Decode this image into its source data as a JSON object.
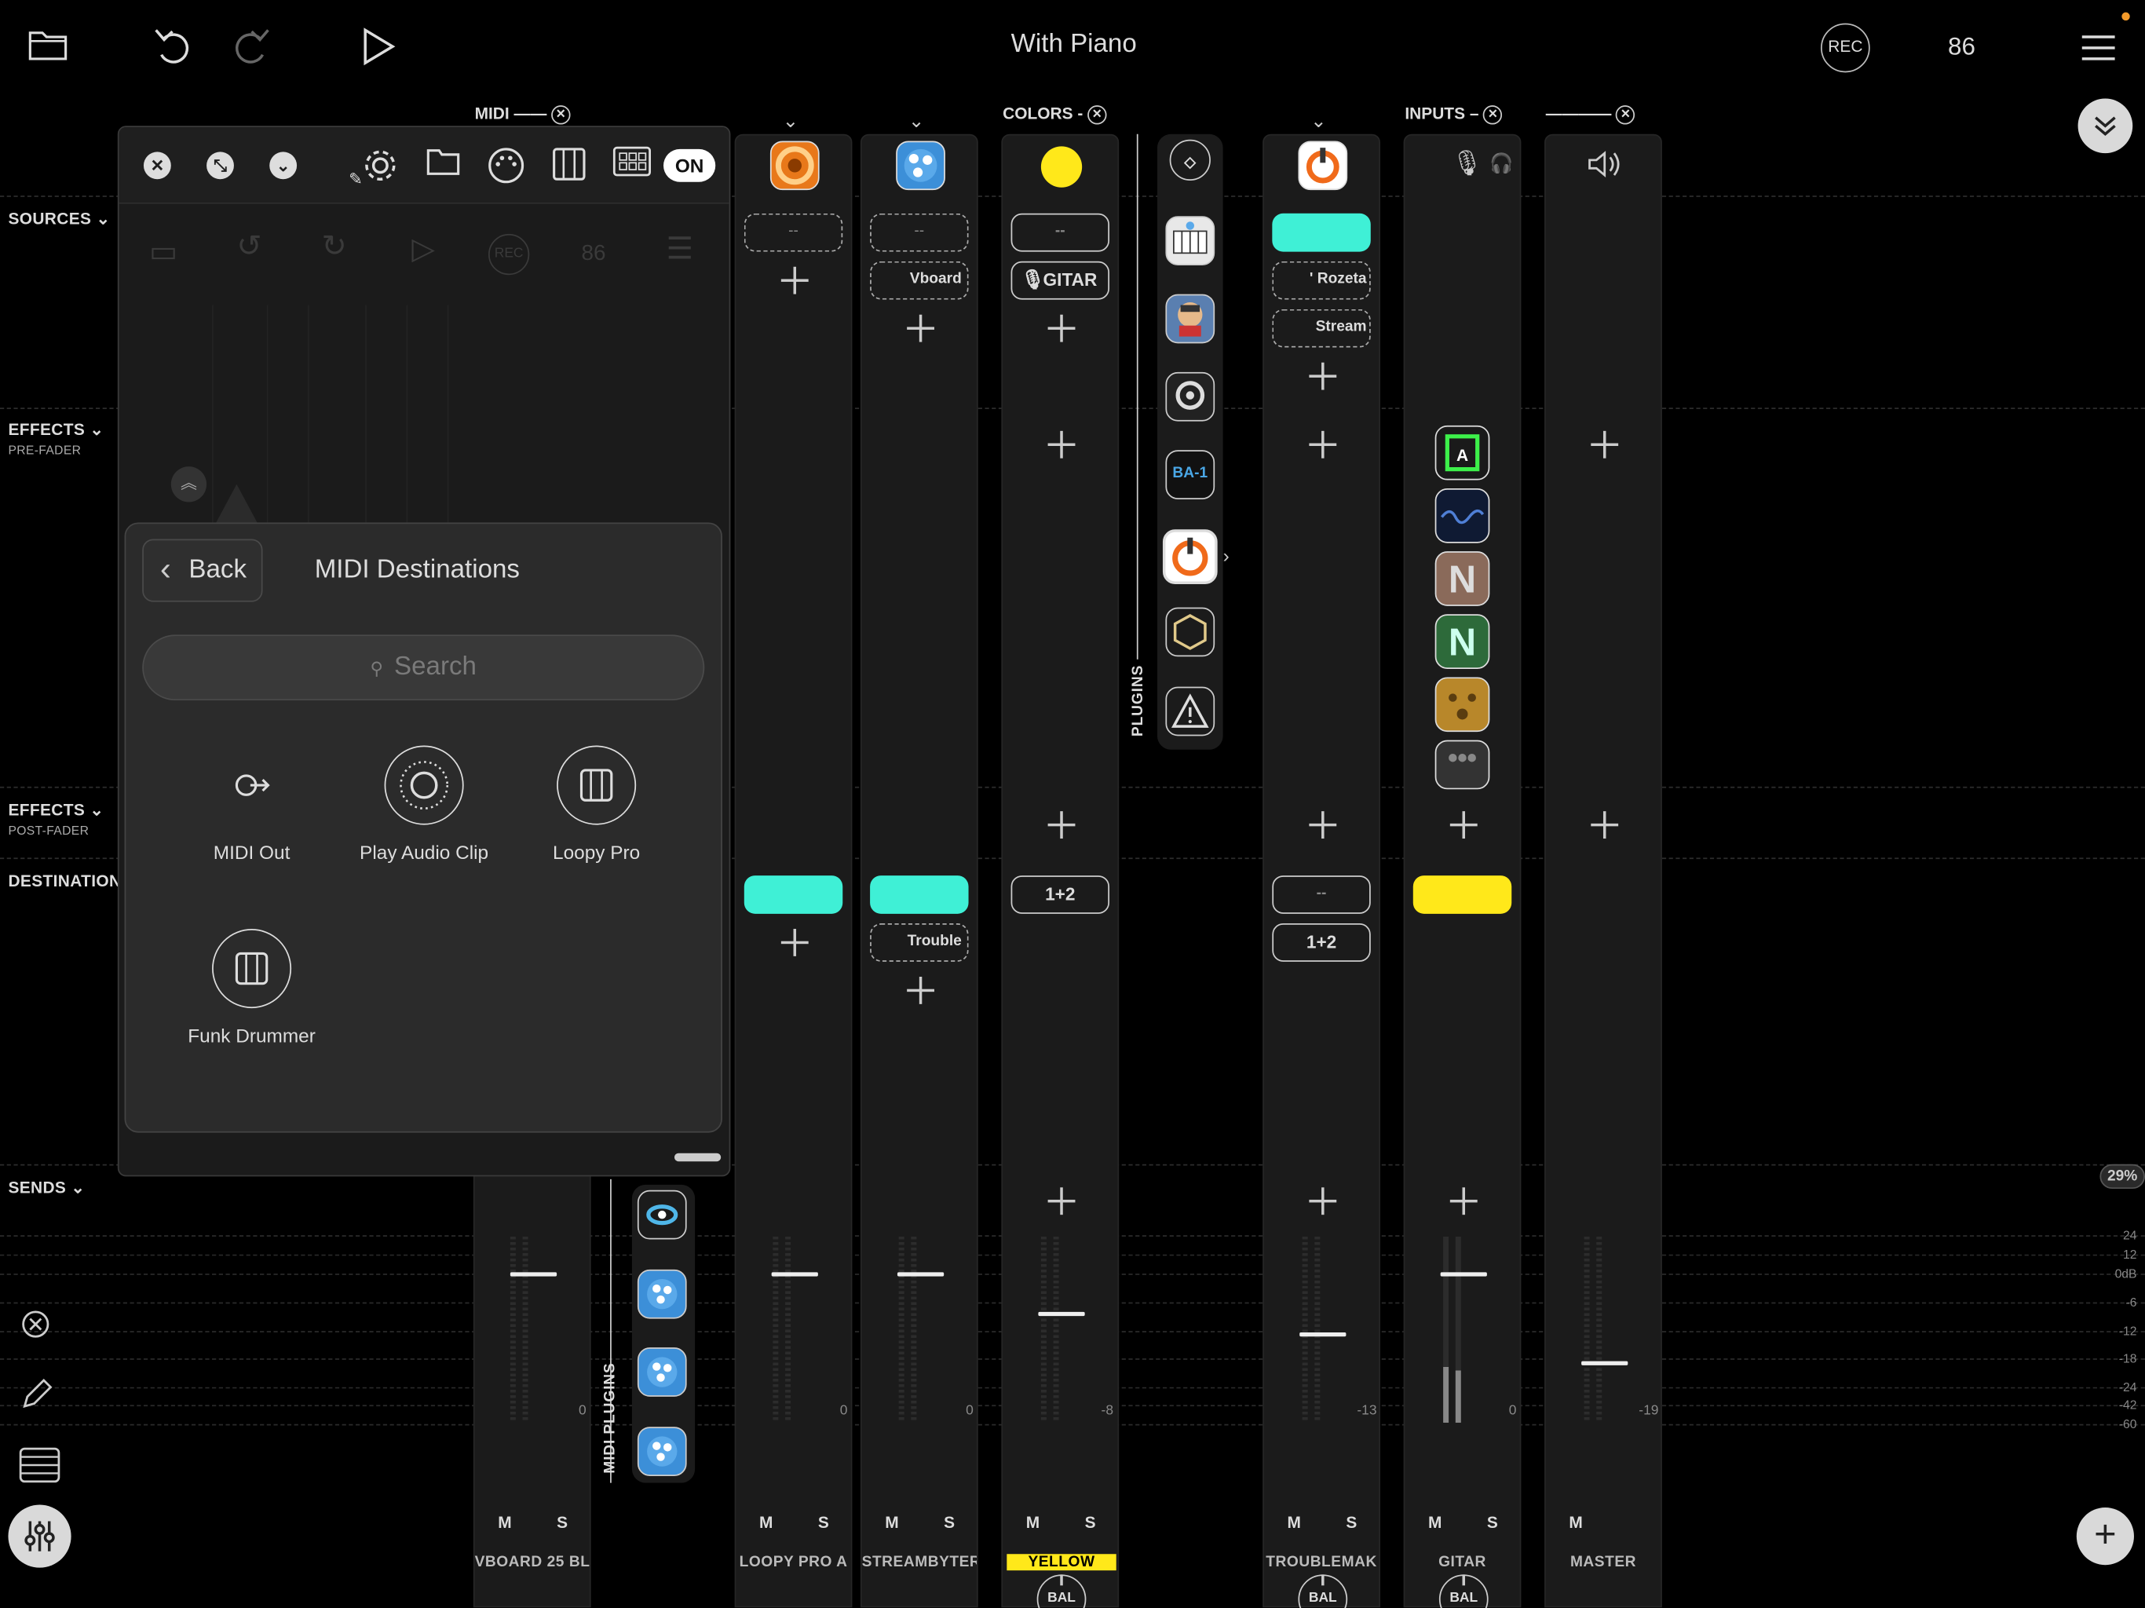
{
  "header": {
    "title": "With Piano",
    "rec_label": "REC",
    "bpm": "86"
  },
  "sections": {
    "sources": "SOURCES",
    "effects_pre": "EFFECTS",
    "effects_pre_sub": "PRE-FADER",
    "effects_post": "EFFECTS",
    "effects_post_sub": "POST-FADER",
    "destinations": "DESTINATION",
    "sends": "SENDS"
  },
  "column_headers": {
    "midi": "MIDI",
    "colors": "COLORS",
    "inputs": "INPUTS",
    "plugins": "PLUGINS",
    "midi_plugins": "MIDI PLUGINS"
  },
  "strips": [
    {
      "name": "VBOARD 25 BL",
      "db": "0",
      "ms": [
        "M",
        "S"
      ]
    },
    {
      "name": "LOOPY PRO A",
      "db": "0",
      "ms": [
        "M",
        "S"
      ],
      "source_slot": "--"
    },
    {
      "name": "STREAMBYTER",
      "db": "0",
      "ms": [
        "M",
        "S"
      ],
      "source_slot": "--",
      "source_item": "Vboard",
      "dest_item": "Trouble"
    },
    {
      "name": "YELLOW",
      "db": "-8",
      "ms": [
        "M",
        "S"
      ],
      "source_slot": "--",
      "source_item": "GITAR",
      "dest_slot": "1+2",
      "bal": "BAL"
    },
    {
      "name": "TROUBLEMAK",
      "db": "-13",
      "ms": [
        "M",
        "S"
      ],
      "source_item_1": "' Rozeta",
      "source_item_2": "Stream",
      "dest_slot_1": "--",
      "dest_slot_2": "1+2",
      "bal": "BAL"
    },
    {
      "name": "GITAR",
      "db": "0",
      "ms": [
        "M",
        "S"
      ],
      "bal": "BAL"
    },
    {
      "name": "MASTER",
      "db": "-19",
      "ms": [
        "M"
      ]
    }
  ],
  "plugins": {
    "ba1": "BA-1"
  },
  "inner_window": {
    "on_label": "ON",
    "ghost_rec": "REC",
    "ghost_bpm": "86"
  },
  "popover": {
    "back_label": "Back",
    "title": "MIDI Destinations",
    "search_placeholder": "Search",
    "items": [
      {
        "label": "MIDI Out",
        "icon": "midi-out-icon"
      },
      {
        "label": "Play Audio Clip",
        "icon": "audio-clip-icon"
      },
      {
        "label": "Loopy Pro",
        "icon": "piano-keys-icon"
      },
      {
        "label": "Funk Drummer",
        "icon": "piano-keys-icon"
      }
    ]
  },
  "meter_scale": [
    "24",
    "12",
    "0dB",
    "-6",
    "-12",
    "-18",
    "-24",
    "-42",
    "-60"
  ],
  "cpu_percent": "29%",
  "colors": {
    "cyan": "#3ff0d6",
    "yellow": "#ffe81a",
    "orange": "#f39a2a"
  }
}
